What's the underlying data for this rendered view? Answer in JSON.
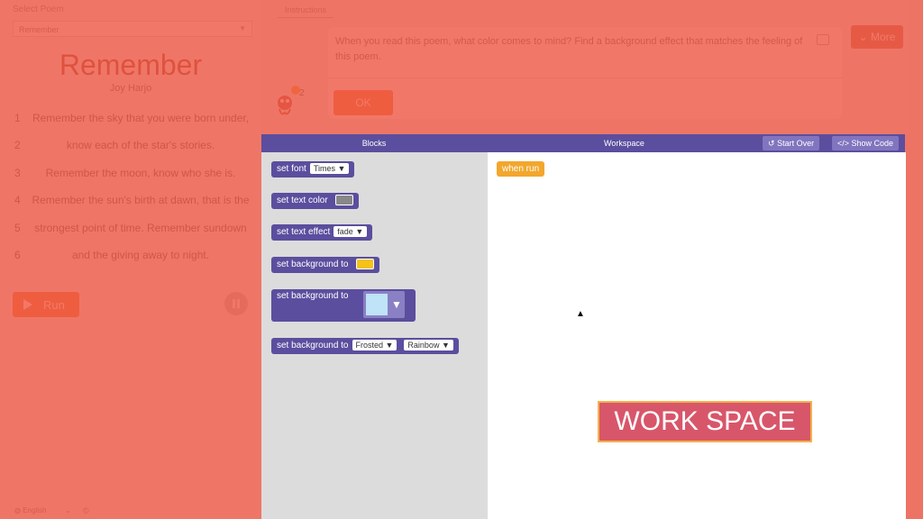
{
  "left_panel": {
    "select_label": "Select Poem",
    "select_value": "Remember",
    "poem_title": "Remember",
    "poem_author": "Joy Harjo",
    "lines": [
      {
        "num": "1",
        "text": "Remember the sky that you were born under,"
      },
      {
        "num": "2",
        "text": "know each of the star's stories."
      },
      {
        "num": "3",
        "text": "Remember the moon, know who she is."
      },
      {
        "num": "4",
        "text": "Remember the sun's birth at dawn, that is the"
      },
      {
        "num": "5",
        "text": "strongest point of time. Remember sundown"
      },
      {
        "num": "6",
        "text": "and the giving away to night."
      }
    ],
    "run_label": "Run",
    "language": "English"
  },
  "instructions": {
    "tab_label": "Instructions",
    "text": "When you read this poem, what color comes to mind? Find a background effect that matches the feeling of this poem.",
    "ok_label": "OK",
    "more_label": "More",
    "mascot_level": "2"
  },
  "headers": {
    "blocks": "Blocks",
    "workspace": "Workspace",
    "start_over": "Start Over",
    "show_code": "Show Code"
  },
  "blocks": {
    "set_font": {
      "label": "set font",
      "value": "Times ▼"
    },
    "set_text_color": {
      "label": "set text color",
      "swatch": "#888888"
    },
    "set_text_effect": {
      "label": "set text effect",
      "value": "fade ▼"
    },
    "set_background_color": {
      "label": "set background to",
      "swatch": "#f5c21b"
    },
    "set_background_image": {
      "label": "set background to",
      "arrow": "▼"
    },
    "set_background_pattern": {
      "label": "set background to",
      "value1": "Frosted ▼",
      "value2": "Rainbow ▼"
    }
  },
  "workspace": {
    "when_run": "when run",
    "label": "WORK SPACE"
  },
  "colors": {
    "overlay": "#ee5a48",
    "block_purple": "#5b4e9e",
    "event_orange": "#f2a72d",
    "run_orange": "#f26b1d"
  }
}
